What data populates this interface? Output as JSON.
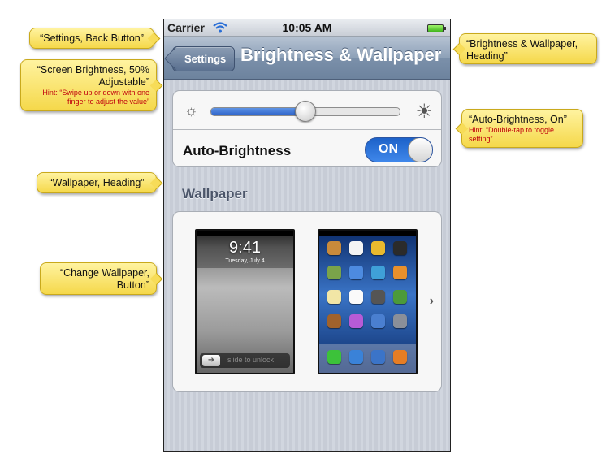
{
  "callouts": {
    "back": "“Settings, Back Button”",
    "brightness_title": "“Screen Brightness, 50% Adjustable”",
    "brightness_hint": "Hint: “Swipe up or down with one finger to adjust the value”",
    "wallpaper_heading": "“Wallpaper, Heading”",
    "change_wallpaper": "“Change Wallpaper, Button”",
    "heading": "“Brightness & Wallpaper, Heading”",
    "auto_title": "“Auto-Brightness, On”",
    "auto_hint": "Hint: “Double-tap to toggle setting”"
  },
  "status": {
    "carrier": "Carrier",
    "time": "10:05 AM"
  },
  "nav": {
    "back_label": "Settings",
    "title": "Brightness & Wallpaper"
  },
  "brightness": {
    "level": 0.5,
    "auto_label": "Auto-Brightness",
    "auto_state": "ON"
  },
  "wallpaper": {
    "heading": "Wallpaper",
    "lock_time": "9:41",
    "lock_date": "Tuesday, July 4",
    "unlock_text": "slide to unlock"
  },
  "colors": {
    "accent": "#2d62c8",
    "callout": "#f5d84a",
    "hint": "#c0000c"
  }
}
